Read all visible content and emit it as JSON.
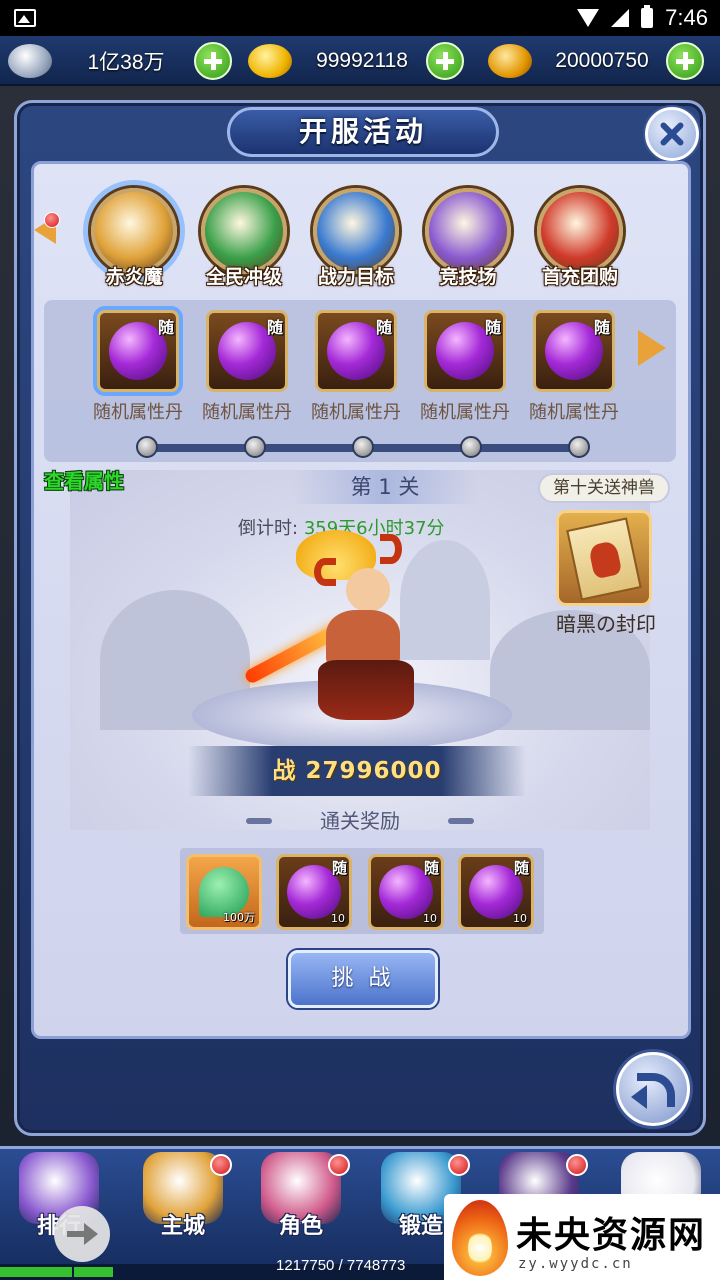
{
  "status_bar": {
    "time": "7:46"
  },
  "currency": [
    {
      "icon": "silver-ingot-icon",
      "value": "1亿38万"
    },
    {
      "icon": "gold-ingot-icon",
      "value": "99992118"
    },
    {
      "icon": "bound-gold-icon",
      "value": "20000750"
    }
  ],
  "panel": {
    "title": "开服活动"
  },
  "tabs": [
    {
      "label": "赤炎魔",
      "active": true,
      "color": "#e0a23a"
    },
    {
      "label": "全民冲级",
      "active": false,
      "color": "#3aa04a"
    },
    {
      "label": "战力目标",
      "active": false,
      "color": "#3a7ad0"
    },
    {
      "label": "竞技场",
      "active": false,
      "color": "#8a5ad0"
    },
    {
      "label": "首充团购",
      "active": false,
      "color": "#d03a2a"
    }
  ],
  "strip_items": [
    {
      "name": "随机属性丹",
      "tag": "随",
      "selected": true
    },
    {
      "name": "随机属性丹",
      "tag": "随",
      "selected": false
    },
    {
      "name": "随机属性丹",
      "tag": "随",
      "selected": false
    },
    {
      "name": "随机属性丹",
      "tag": "随",
      "selected": false
    },
    {
      "name": "随机属性丹",
      "tag": "随",
      "selected": false
    }
  ],
  "view_attributes_label": "查看属性",
  "stage": {
    "title": "第 1 关",
    "countdown_label": "倒计时:",
    "countdown_value": "359天6小时37分",
    "tenth_stage_label": "第十关送神兽",
    "beast_name": "暗黑の封印",
    "power_label": "战 27996000",
    "rewards_title": "通关奖励"
  },
  "rewards": [
    {
      "type": "jade",
      "tag": "",
      "qty": "100万"
    },
    {
      "type": "orb",
      "tag": "随",
      "qty": "10"
    },
    {
      "type": "orb",
      "tag": "随",
      "qty": "10"
    },
    {
      "type": "orb",
      "tag": "随",
      "qty": "10"
    }
  ],
  "challenge_label": "挑 战",
  "bottom_nav": [
    {
      "label": "排行",
      "color": "#8a5ad0",
      "badge": false
    },
    {
      "label": "主城",
      "color": "#e0a23a",
      "badge": true
    },
    {
      "label": "角色",
      "color": "#d05a8a",
      "badge": true
    },
    {
      "label": "锻造",
      "color": "#3a9ad0",
      "badge": true
    },
    {
      "label": "",
      "color": "#5a3a8a",
      "badge": true
    },
    {
      "label": "",
      "color": "#e8e8f0",
      "badge": false
    }
  ],
  "exp": {
    "text": "1217750 / 7748773",
    "fraction": 0.157
  },
  "watermark": {
    "text": "未央资源网",
    "url": "zy.wyydc.cn"
  }
}
